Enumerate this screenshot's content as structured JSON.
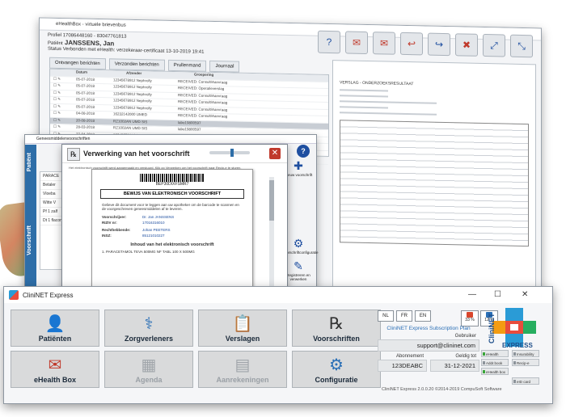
{
  "back_window": {
    "title": "eHealthBox - virtuele brievenbus",
    "profiel_label": "Profiel",
    "profiel_value": "17086448160 - 83047761813",
    "patient_label": "Patiënt",
    "patient_value": "JANSSENS, Jan",
    "status_label": "Status",
    "status_value": "Verbonden met eHealth: verzekeraar-certificaat 13-10-2019 19:41",
    "tabs": [
      "Ontvangen berichten",
      "Verzonden berichten",
      "Prullenmand",
      "Journaal"
    ],
    "grid_headers": [
      "Datum",
      "Afzender",
      "Groepering"
    ],
    "grid_rows": [
      {
        "date": "05-07-2018",
        "sender": "12345678912 Nephrolly",
        "group": "RECEIVED: Consult/Aanvraag"
      },
      {
        "date": "05-07-2018",
        "sender": "12345678912 Nephrolly",
        "group": "RECEIVED: Operatieverslag"
      },
      {
        "date": "05-07-2018",
        "sender": "12345678912 Nephrolly",
        "group": "RECEIVED: Consult/Aanvraag"
      },
      {
        "date": "05-07-2018",
        "sender": "12345678912 Nephrolly",
        "group": "RECEIVED: Consult/Aanvraag"
      },
      {
        "date": "05-07-2018",
        "sender": "12345678912 Nephrolly",
        "group": "RECEIVED: Consult/Aanvraag"
      },
      {
        "date": "04-08-2018",
        "sender": "16232142000 UMED",
        "group": "RECEIVED: Consult/Aanvraag"
      },
      {
        "date": "20-08-2018",
        "sender": "RZ1002AN UMD SIS",
        "group": "labo19800597"
      },
      {
        "date": "28-03-2018",
        "sender": "RZ1002AN UMD SIS",
        "group": "labo19800597"
      },
      {
        "date": "27-04-2018",
        "sender": "12345678912 Nephrolly",
        "group": "RECEIVED: Consult/Aanvraag"
      },
      {
        "date": "27-04-2018",
        "sender": "12345678912 Nephrolly",
        "group": "RECEIVED: Consult/Aanvraag"
      },
      {
        "date": "27-04-2018",
        "sender": "12345678912 Nephrolly",
        "group": "RECEIVED: Consult/Aanvraag"
      },
      {
        "date": "27-04-2018",
        "sender": "12345678912 Nephrolly",
        "group": "RECEIVED: Consult/Aanvraag"
      }
    ],
    "report_title": "VERSLAG - ONDERZOEKSRESULTAAT"
  },
  "mid_window": {
    "title": "Geneesmiddelenvoorschriften",
    "side_tabs": [
      "Patiënt",
      "Voorschrift"
    ],
    "list_items": [
      "PARACE",
      "Betaler",
      "Vloeba",
      "Witte V",
      "Pf 1 zalf",
      "Dt 1 flacon"
    ],
    "action_labels": [
      "Nieuw voorschrift",
      "Voorschriftconfiguratie",
      "Registreren en verwerken"
    ]
  },
  "dialog": {
    "title": "Verwerking van het voorschrift",
    "subtitle": "Het elektronisch voorschrift werd aangemaakt en verstuurd. Klik op Verwerken om het voorschrift naar Recip-e te sturen.",
    "code": "BEP30DIXFSMR7",
    "doc_header": "BEWIJS VAN ELEKTRONISCH VOORSCHRIFT",
    "doc_intro": "Gelieve dit document voor te leggen aan uw apotheker om de barcode te scannen en de voorgeschreven geneesmiddelen af te leveren.",
    "voorschrijver_label": "Voorschrijver:",
    "voorschrijver_value": "Dr. Jan JANSSENS",
    "riziv_label": "RIZIV nr:",
    "riziv_value": "17016316010",
    "rechthebbende_label": "Rechthebbende:",
    "rechthebbende_value": "Johan PEETERS",
    "inss_label": "INSZ:",
    "inss_value": "85121010227",
    "content_header": "Inhoud van het elektronisch voorschrift",
    "content_item": "1. PARACETAMOL TEVA 500MG NF TABL 100 X 500MG"
  },
  "main_window": {
    "title": "CliniNET Express",
    "tiles": [
      {
        "label": "Patiënten",
        "icon": "👤",
        "enabled": true
      },
      {
        "label": "Zorgverleners",
        "icon": "👨‍⚕",
        "enabled": true
      },
      {
        "label": "Verslagen",
        "icon": "📋",
        "enabled": true
      },
      {
        "label": "Voorschriften",
        "icon": "℞",
        "enabled": true
      },
      {
        "label": "eHealth Box",
        "icon": "📦",
        "enabled": true
      },
      {
        "label": "Agenda",
        "icon": "▦",
        "enabled": false
      },
      {
        "label": "Aanrekeningen",
        "icon": "▤",
        "enabled": false
      },
      {
        "label": "Configuratie",
        "icon": "⚙",
        "enabled": true
      }
    ],
    "languages": [
      "NL",
      "FR",
      "EN"
    ],
    "stat1": "33 %",
    "stat2": "12 %",
    "plan": "CliniNET Express Subscription Plan",
    "gebruiker_label": "Gebruiker",
    "gebruiker_value": "support@clininet.com",
    "abonnement_label": "Abonnement",
    "abonnement_value": "123DEABC",
    "geldig_label": "Geldig tot",
    "geldig_value": "31-12-2021",
    "brand_top": "CliniNET",
    "brand_bottom": "EXPRESS",
    "features": [
      {
        "label": "eHealth",
        "on": true
      },
      {
        "label": "Insurability",
        "on": false
      },
      {
        "label": "Addr.book",
        "on": false
      },
      {
        "label": "Recip-e",
        "on": false
      },
      {
        "label": "eHealth box",
        "on": true
      },
      {
        "label": "eID card",
        "on": false
      }
    ],
    "footer": "CliniNET Express 2.0.0.20 ©2014-2019 CompuSoft Software",
    "colors": {
      "accent": "#2a6fb6",
      "brand_red": "#e84c3d",
      "brand_blue": "#2a9bd6",
      "tile_bg": "#d9dadb"
    }
  }
}
